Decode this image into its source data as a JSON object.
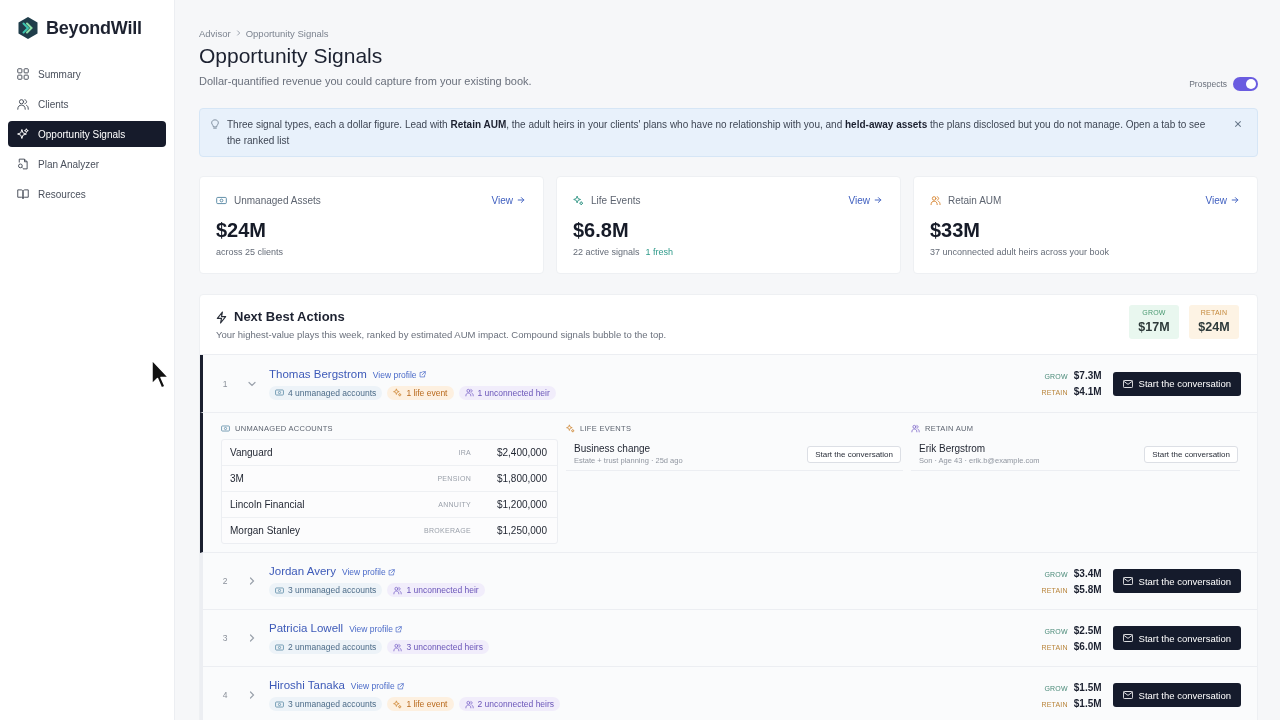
{
  "sidebar": {
    "brand": "BeyondWill",
    "items": [
      {
        "label": "Summary",
        "selected": false
      },
      {
        "label": "Clients",
        "selected": false
      },
      {
        "label": "Opportunity Signals",
        "selected": true
      },
      {
        "label": "Plan Analyzer",
        "selected": false
      },
      {
        "label": "Resources",
        "selected": false
      }
    ]
  },
  "header": {
    "breadcrumb": [
      "Advisor",
      "Opportunity Signals"
    ],
    "title": "Opportunity Signals",
    "subtitle": "Dollar-quantified revenue you could capture from your existing book.",
    "prospects_toggle": {
      "label": "Prospects",
      "on": true
    }
  },
  "banner": {
    "text": "Three signal types, each a dollar figure. Lead with **Retain AUM**, the adult heirs in your clients' plans who have no relationship with you, and **held-away assets** the plans disclosed but you do not manage. Open a tab to see the ranked list"
  },
  "stat_cards": [
    {
      "kind": "unmanaged",
      "label": "Unmanaged Assets",
      "link": "View",
      "value": "$24M",
      "caption": "across 25 clients"
    },
    {
      "kind": "life",
      "label": "Life Events",
      "link": "View",
      "value": "$6.8M",
      "caption": "22 active signals",
      "highlight": "1 fresh"
    },
    {
      "kind": "retain",
      "label": "Retain AUM",
      "link": "View",
      "value": "$33M",
      "caption": "37 unconnected adult heirs across your book"
    }
  ],
  "actions": {
    "title": "Next Best Actions",
    "subtitle": "Your highest-value plays this week, ranked by estimated AUM impact. Compound signals bubble to the top.",
    "totals": [
      {
        "kind": "grow",
        "label": "GROW",
        "value": "$17M"
      },
      {
        "kind": "retain",
        "label": "RETAIN",
        "value": "$24M"
      }
    ],
    "rows": [
      {
        "rank": "1",
        "name": "Thomas Bergstrom",
        "profile_link": "View profile",
        "expanded": true,
        "tags": [
          {
            "kind": "accounts",
            "label": "4 unmanaged accounts"
          },
          {
            "kind": "life_event",
            "label": "1 life event"
          },
          {
            "kind": "heir",
            "label": "1 unconnected heir"
          }
        ],
        "metrics": [
          {
            "kind": "grow",
            "label": "GROW",
            "value": "$7.3M"
          },
          {
            "kind": "retain",
            "label": "RETAIN",
            "value": "$4.1M"
          }
        ],
        "action": "Start the conversation",
        "detail": [
          {
            "kind": "accounts",
            "title": "UNMANAGED ACCOUNTS",
            "rows": [
              {
                "name": "Vanguard",
                "type": "IRA",
                "amount": "$2,400,000"
              },
              {
                "name": "3M",
                "type": "PENSION",
                "amount": "$1,800,000"
              },
              {
                "name": "Lincoln Financial",
                "type": "ANNUITY",
                "amount": "$1,200,000"
              },
              {
                "name": "Morgan Stanley",
                "type": "BROKERAGE",
                "amount": "$1,250,000"
              }
            ]
          },
          {
            "kind": "life_event",
            "title": "LIFE EVENTS",
            "items": [
              {
                "title": "Business change",
                "meta": "Estate + trust planning · 25d ago",
                "action": "Start the conversation"
              }
            ]
          },
          {
            "kind": "heir",
            "title": "RETAIN AUM",
            "items": [
              {
                "title": "Erik Bergstrom",
                "meta": "Son · Age 43 · erik.b@example.com",
                "action": "Start the conversation"
              }
            ]
          }
        ]
      },
      {
        "rank": "2",
        "name": "Jordan Avery",
        "profile_link": "View profile",
        "expanded": false,
        "tags": [
          {
            "kind": "accounts",
            "label": "3 unmanaged accounts"
          },
          {
            "kind": "heir",
            "label": "1 unconnected heir"
          }
        ],
        "metrics": [
          {
            "kind": "grow",
            "label": "GROW",
            "value": "$3.4M"
          },
          {
            "kind": "retain",
            "label": "RETAIN",
            "value": "$5.8M"
          }
        ],
        "action": "Start the conversation"
      },
      {
        "rank": "3",
        "name": "Patricia Lowell",
        "profile_link": "View profile",
        "expanded": false,
        "tags": [
          {
            "kind": "accounts",
            "label": "2 unmanaged accounts"
          },
          {
            "kind": "heir",
            "label": "3 unconnected heirs"
          }
        ],
        "metrics": [
          {
            "kind": "grow",
            "label": "GROW",
            "value": "$2.5M"
          },
          {
            "kind": "retain",
            "label": "RETAIN",
            "value": "$6.0M"
          }
        ],
        "action": "Start the conversation"
      },
      {
        "rank": "4",
        "name": "Hiroshi Tanaka",
        "profile_link": "View profile",
        "expanded": false,
        "tags": [
          {
            "kind": "accounts",
            "label": "3 unmanaged accounts"
          },
          {
            "kind": "life_event",
            "label": "1 life event"
          },
          {
            "kind": "heir",
            "label": "2 unconnected heirs"
          }
        ],
        "metrics": [
          {
            "kind": "grow",
            "label": "GROW",
            "value": "$1.5M"
          },
          {
            "kind": "retain",
            "label": "RETAIN",
            "value": "$1.5M"
          }
        ],
        "action": "Start the conversation"
      }
    ]
  }
}
